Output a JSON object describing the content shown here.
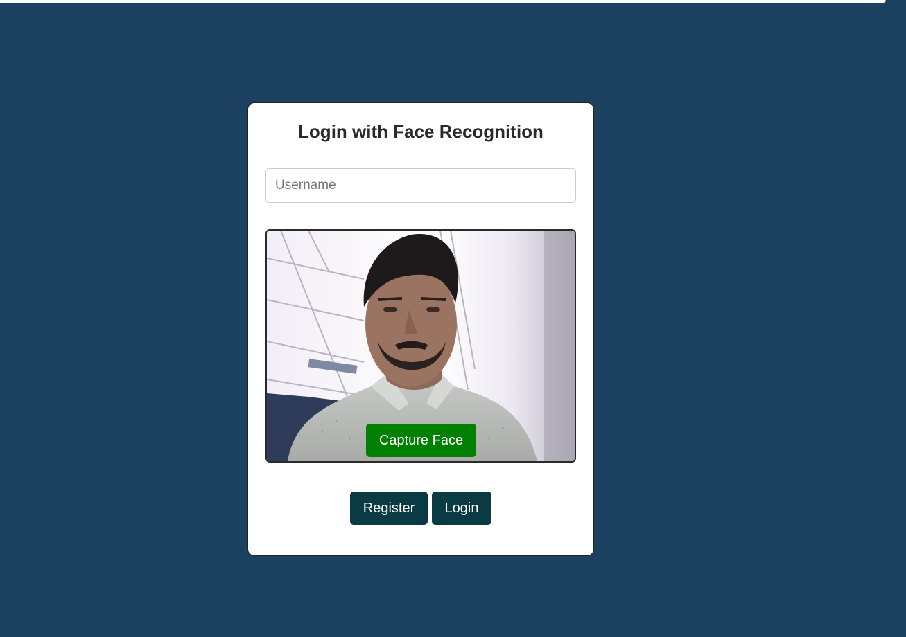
{
  "page": {
    "background_color": "#1b4060"
  },
  "login_card": {
    "title": "Login with Face Recognition",
    "username": {
      "placeholder": "Username",
      "value": ""
    },
    "camera": {
      "capture_label": "Capture Face"
    },
    "actions": {
      "register_label": "Register",
      "login_label": "Login"
    }
  },
  "colors": {
    "capture_button": "#008000",
    "action_buttons": "#0a3b45",
    "card_background": "#ffffff"
  }
}
